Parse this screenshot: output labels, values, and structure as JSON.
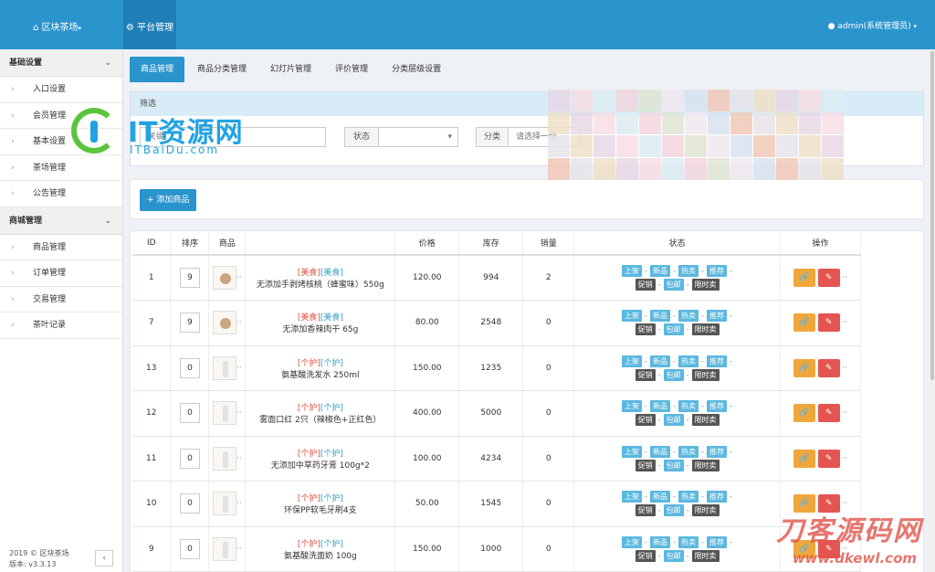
{
  "header": {
    "brand": "区块茶场",
    "active_nav": "平台管理",
    "user": "admin(系统管理员)"
  },
  "sidebar": {
    "sections": [
      {
        "title": "基础设置",
        "items": [
          "入口设置",
          "会员管理",
          "基本设置",
          "茶场管理",
          "公告管理"
        ]
      },
      {
        "title": "商城管理",
        "items": [
          "商品管理",
          "订单管理",
          "交易管理",
          "茶叶记录"
        ]
      }
    ],
    "footer_copyright": "2019 © 区块茶场",
    "footer_version": "版本: v3.3.13"
  },
  "tabs": [
    "商品管理",
    "商品分类管理",
    "幻灯片管理",
    "评价管理",
    "分类层级设置"
  ],
  "filter": {
    "title": "筛选",
    "keyword_placeholder": "关键",
    "status_label": "状态",
    "category_label": "分类",
    "category_select": "请选择一级"
  },
  "add_button": "添加商品",
  "table": {
    "headers": [
      "ID",
      "排序",
      "商品",
      "",
      "价格",
      "库存",
      "销量",
      "状态",
      "操作"
    ],
    "rows": [
      {
        "id": "1",
        "sort": "9",
        "cat1": "[美食]",
        "cat2": "[美食]",
        "name": "无添加手剥烤核桃（蜂蜜味）550g",
        "price": "120.00",
        "stock": "994",
        "sales": "2"
      },
      {
        "id": "7",
        "sort": "9",
        "cat1": "[美食]",
        "cat2": "[美食]",
        "name": "无添加香辣肉干 65g",
        "price": "80.00",
        "stock": "2548",
        "sales": "0"
      },
      {
        "id": "13",
        "sort": "0",
        "cat1": "[个护]",
        "cat2": "[个护]",
        "name": "氨基酸洗发水 250ml",
        "price": "150.00",
        "stock": "1235",
        "sales": "0"
      },
      {
        "id": "12",
        "sort": "0",
        "cat1": "[个护]",
        "cat2": "[个护]",
        "name": "雾面口红 2只（辣椒色+正红色）",
        "price": "400.00",
        "stock": "5000",
        "sales": "0"
      },
      {
        "id": "11",
        "sort": "0",
        "cat1": "[个护]",
        "cat2": "[个护]",
        "name": "无添加中草药牙膏 100g*2",
        "price": "100.00",
        "stock": "4234",
        "sales": "0"
      },
      {
        "id": "10",
        "sort": "0",
        "cat1": "[个护]",
        "cat2": "[个护]",
        "name": "环保PP软毛牙刷4支",
        "price": "50.00",
        "stock": "1545",
        "sales": "0"
      },
      {
        "id": "9",
        "sort": "0",
        "cat1": "[个护]",
        "cat2": "[个护]",
        "name": "氨基酸洗面奶 100g",
        "price": "150.00",
        "stock": "1000",
        "sales": "0"
      }
    ],
    "status_tags_top": [
      "上架",
      "新品",
      "热卖",
      "推荐"
    ],
    "status_tags_bottom": [
      "促销",
      "包邮",
      "限时卖"
    ]
  },
  "watermark": {
    "main": "IT资源网",
    "sub": "ITBaiDu.com",
    "main2": "刀客源码网",
    "sub2": "www.dkewl.com"
  },
  "colors": {
    "primary": "#2a94cd",
    "tag_blue": "#5bb8df",
    "tag_dark": "#555555",
    "btn_orange": "#f0a73a",
    "btn_red": "#e45551"
  }
}
